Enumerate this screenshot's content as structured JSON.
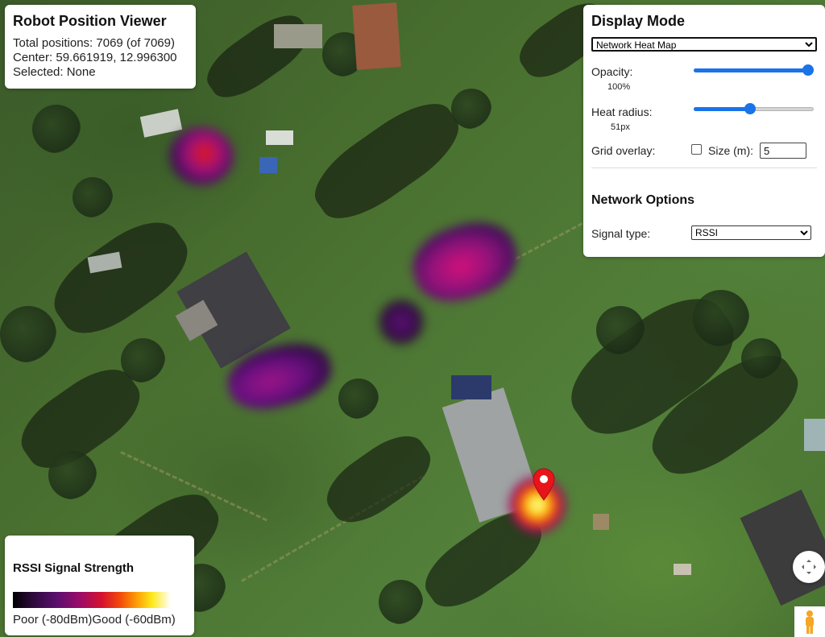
{
  "info": {
    "title": "Robot Position Viewer",
    "total_positions": "Total positions: 7069 (of 7069)",
    "center": "Center: 59.661919, 12.996300",
    "selected": "Selected: None"
  },
  "display": {
    "title": "Display Mode",
    "mode_selected": "Network Heat Map",
    "opacity_label": "Opacity:",
    "opacity_value": "100%",
    "opacity_level": 1.0,
    "radius_label": "Heat radius:",
    "radius_value": "51px",
    "radius_level": 0.47,
    "grid_label": "Grid overlay:",
    "size_label": "Size (m):",
    "size_value": "5",
    "grid_checked": false,
    "network_title": "Network Options",
    "signal_label": "Signal type:",
    "signal_selected": "RSSI"
  },
  "legend": {
    "title": "RSSI Signal Strength",
    "poor": "Poor (-80dBm)",
    "good": "Good (-60dBm)"
  },
  "icons": {
    "marker": "map-marker-icon",
    "fullscreen": "fullscreen-icon",
    "pegman": "pegman-icon"
  },
  "colors": {
    "accent": "#1a73e8",
    "marker": "#e8141b"
  }
}
